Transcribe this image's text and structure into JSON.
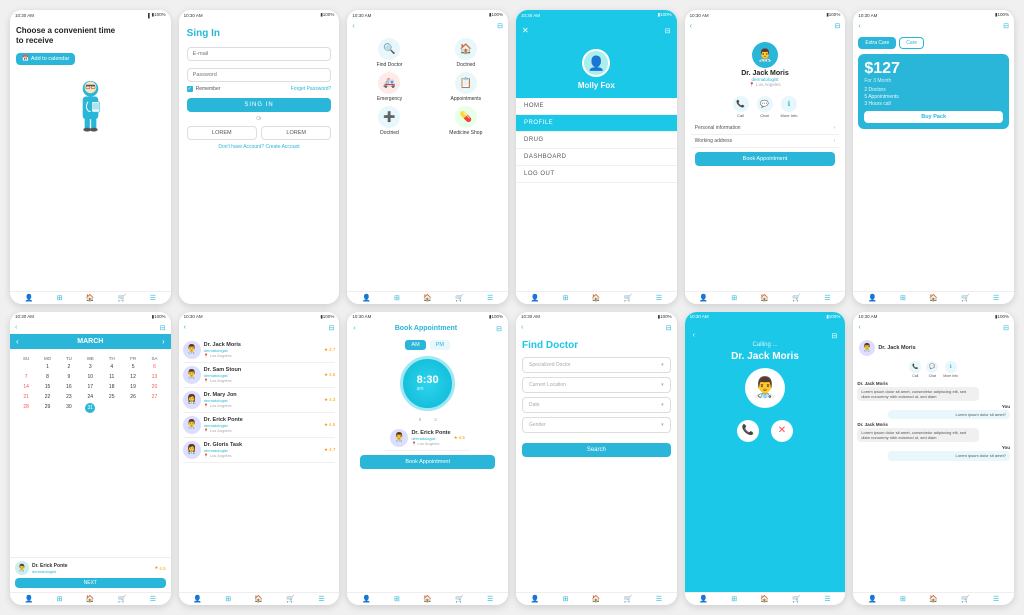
{
  "phones": {
    "p1": {
      "status_time": "10:30 AM",
      "title": "Choose a convenient time\nto receive",
      "btn_label": "Add to calendar"
    },
    "p2": {
      "status_time": "10:30 AM",
      "title": "Sing In",
      "email_placeholder": "E-mail",
      "password_placeholder": "Password",
      "remember_label": "Remember",
      "forgot_label": "Forget Password?",
      "signin_btn": "SING IN",
      "or_label": "Or",
      "lorem1": "LOREM",
      "lorem2": "LOREM",
      "no_account": "Don't have Account?",
      "create": "Create Account"
    },
    "p3": {
      "status_time": "10:30 AM",
      "items": [
        {
          "label": "Find Doctor",
          "icon": "🔍"
        },
        {
          "label": "Doctried",
          "icon": "🏠"
        },
        {
          "label": "Emergency",
          "icon": "🚑"
        },
        {
          "label": "Appointments",
          "icon": "📋"
        },
        {
          "label": "Doctried",
          "icon": "➕"
        },
        {
          "label": "Medicine Shop",
          "icon": "💊"
        }
      ]
    },
    "p4": {
      "status_time": "10:30 AM",
      "user_name": "Molly Fox",
      "menu": [
        "HOME",
        "PROFILE",
        "DRUG",
        "DASHBOARD",
        "LOG OUT"
      ],
      "active": "PROFILE"
    },
    "p5": {
      "status_time": "10:30 AM",
      "doc_name": "Dr. Jack Moris",
      "doc_spec": "dermatologist",
      "doc_loc": "Los Angeles",
      "actions": [
        "Call",
        "Chat",
        "More Info"
      ],
      "info_rows": [
        "Personal Information",
        "Working address"
      ],
      "book_btn": "Book Appointment"
    },
    "p6": {
      "status_time": "10:30 AM",
      "tabs": [
        "Extra Care",
        "Care"
      ],
      "active_tab": "Extra Care",
      "price": "$127",
      "duration": "For 3 Month",
      "features": [
        "2 Doctors",
        "5 Appointments",
        "3 Hours call"
      ],
      "buy_btn": "Buy Pack"
    },
    "p7": {
      "status_time": "10:30 AM",
      "month": "MARCH",
      "day_headers": [
        "SU",
        "MO",
        "TU",
        "WE",
        "TH",
        "FR",
        "SA"
      ],
      "days": [
        [
          "",
          "1",
          "2",
          "3",
          "4",
          "5",
          "6"
        ],
        [
          "7",
          "8",
          "9",
          "10",
          "11",
          "12",
          "13"
        ],
        [
          "14",
          "15",
          "16",
          "17",
          "18",
          "19",
          "20"
        ],
        [
          "21",
          "22",
          "23",
          "24",
          "25",
          "26",
          "27"
        ],
        [
          "28",
          "29",
          "30",
          "31",
          "",
          "",
          ""
        ]
      ],
      "today": "31",
      "doc_name": "Dr. Erick Ponte",
      "doc_spec": "dermatologist",
      "doc_rating": "4.5",
      "next_btn": "NEXT"
    },
    "p8": {
      "status_time": "10:30 AM",
      "doctors": [
        {
          "name": "Dr. Jack Moris",
          "spec": "dermatologist",
          "loc": "Los Angeles",
          "rating": "4.7"
        },
        {
          "name": "Dr. Sam Stoun",
          "spec": "dermatologist",
          "loc": "Los Angeles",
          "rating": "4.5"
        },
        {
          "name": "Dr. Mary Jon",
          "spec": "dermatologist",
          "loc": "Los Angeles",
          "rating": "4.3"
        },
        {
          "name": "Dr. Erick Ponte",
          "spec": "dermatologist",
          "loc": "Los Angeles",
          "rating": "4.5"
        },
        {
          "name": "Dr. Gloris Task",
          "spec": "dermatologist",
          "loc": "Los Angeles",
          "rating": "4.7"
        }
      ]
    },
    "p9": {
      "status_time": "10:30 AM",
      "title": "Book Appointment",
      "am": "AM",
      "pm": "PM",
      "time": "8:30",
      "time_sub": "am",
      "book_btn": "Book Appointment",
      "doc_name": "Dr. Erick Ponte",
      "doc_rating": "4.5"
    },
    "p10": {
      "status_time": "10:30 AM",
      "title": "Find Doctor",
      "selects": [
        "Specialized Doctor",
        "Current Location",
        "Date",
        "Gender"
      ],
      "search_btn": "Search"
    },
    "p11": {
      "status_time": "10:30 AM",
      "calling_label": "Calling ...",
      "doc_name": "Dr. Jack Moris"
    },
    "p12": {
      "status_time": "10:30 AM",
      "doc_name": "Dr. Jack Moris",
      "actions": [
        "Call",
        "Chat",
        "More Info"
      ],
      "messages": [
        {
          "sender": "Dr. Jack Moris",
          "text": "Lorem ipsum dolor sit amet, consectetur adipiscing elit, sed diam nonummy nibh euismod ut, sed diam",
          "you": false
        },
        {
          "sender": "You",
          "text": "Lorem ipsum dolor sit amet?",
          "you": true
        },
        {
          "sender": "Dr. Jack Moris",
          "text": "Lorem ipsum dolor sit amet, consectetur adipiscing elit, sed diam nonummy nibh euismod ut, sed diam",
          "you": false
        },
        {
          "sender": "You",
          "text": "Lorem ipsum dolor sit amet?",
          "you": true
        }
      ]
    }
  }
}
